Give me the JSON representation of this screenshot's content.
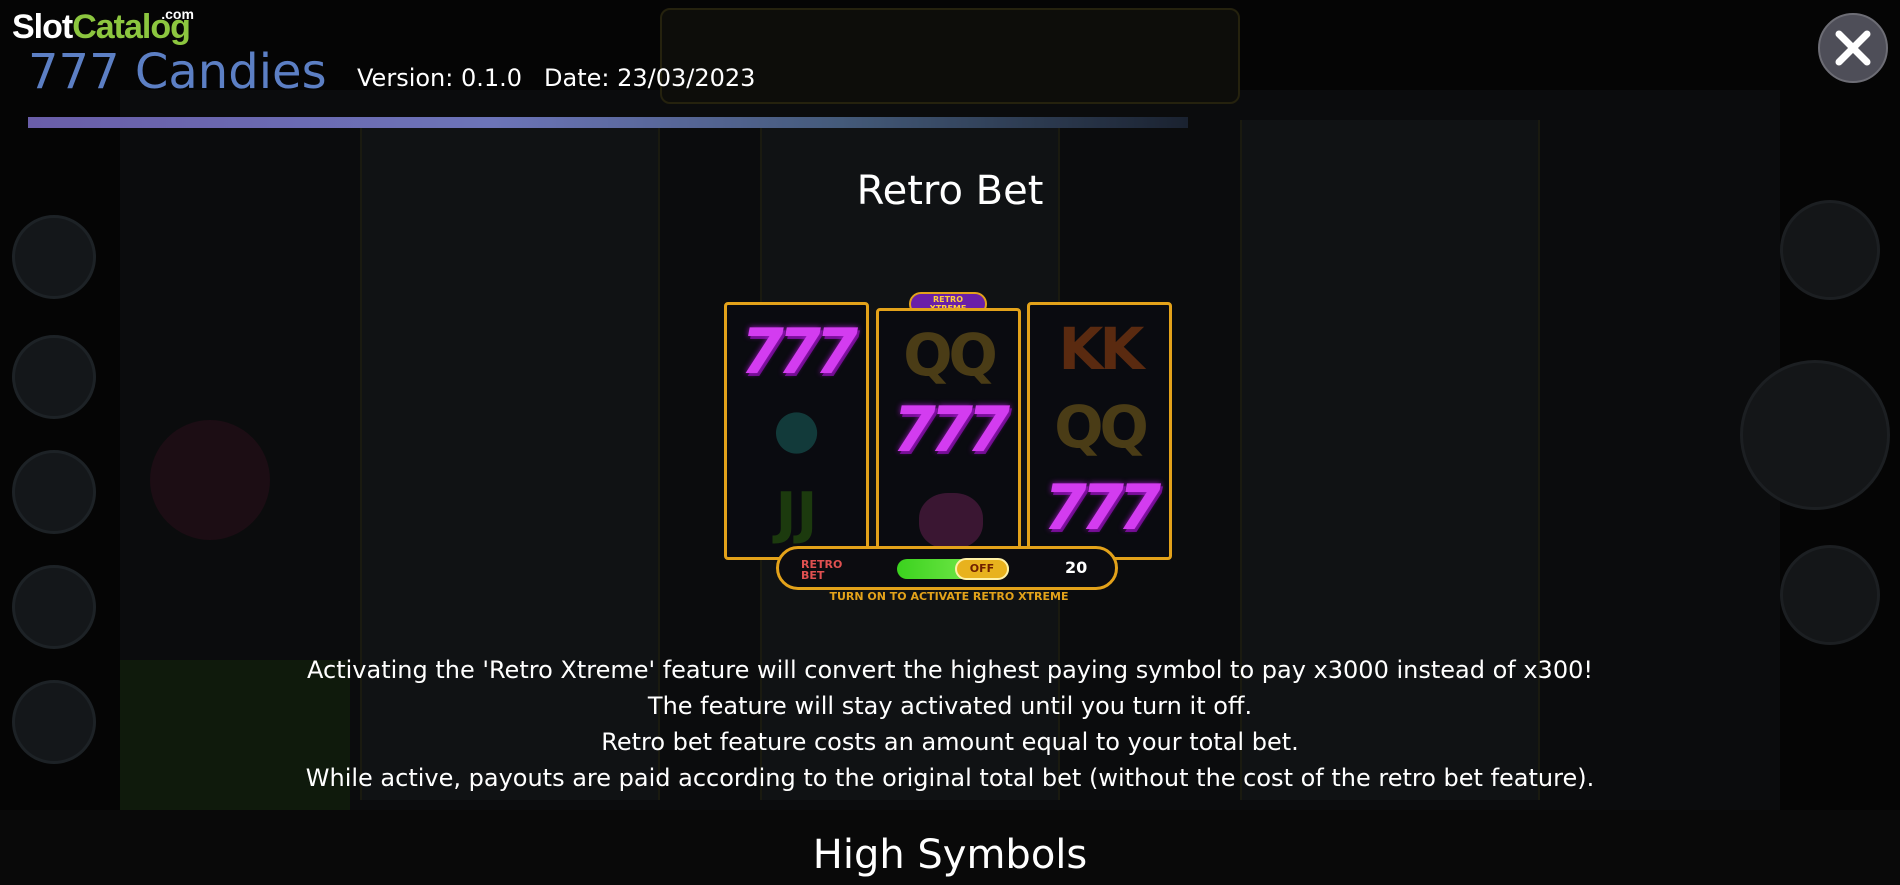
{
  "logo": {
    "part1": "Slot",
    "part2": "Catalog",
    "suffix": ".com"
  },
  "header": {
    "game_title": "777 Candies",
    "version": "Version: 0.1.0",
    "date": "Date: 23/03/2023"
  },
  "colors": {
    "title_blue": "#5c7fc4",
    "accent_gold": "#e3a21a",
    "logo_green": "#8cc63f"
  },
  "close_icon": "close-icon",
  "section": {
    "title": "Retro Bet",
    "illustration": {
      "badge_line1": "RETRO",
      "badge_line2": "XTREME",
      "retro_label_line1": "RETRO",
      "retro_label_line2": "BET",
      "toggle_state": "OFF",
      "bet_value": "20",
      "hint": "TURN ON TO ACTIVATE RETRO XTREME",
      "reels": [
        [
          "777",
          "bear",
          "JJ"
        ],
        [
          "QQ",
          "777",
          "brain"
        ],
        [
          "KK",
          "QQ",
          "777"
        ]
      ]
    },
    "description": [
      "Activating the 'Retro Xtreme' feature will convert the highest paying symbol to pay x3000 instead of x300!",
      "The feature will stay activated until you turn it off.",
      "Retro bet feature costs an amount equal to your total bet.",
      "While active, payouts are paid according to the original total bet (without the cost of the retro bet feature)."
    ]
  },
  "next_section": {
    "title": "High Symbols"
  }
}
